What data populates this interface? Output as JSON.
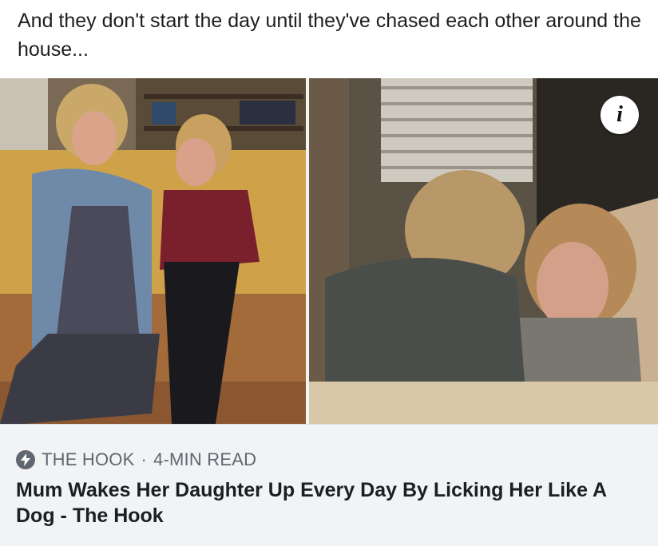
{
  "post": {
    "text": "And they don't start the day until they've chased each other around the house..."
  },
  "media": {
    "info_button_label": "i",
    "info_icon": "info-icon"
  },
  "link_card": {
    "source": "THE HOOK",
    "separator": "·",
    "read_time": "4-MIN READ",
    "source_icon": "lightning-bolt-icon",
    "headline": "Mum Wakes Her Daughter Up Every Day By Licking Her Like A Dog - The Hook"
  },
  "colors": {
    "text_primary": "#1c1e21",
    "text_secondary": "#606770",
    "card_background": "#f2f3f5"
  }
}
